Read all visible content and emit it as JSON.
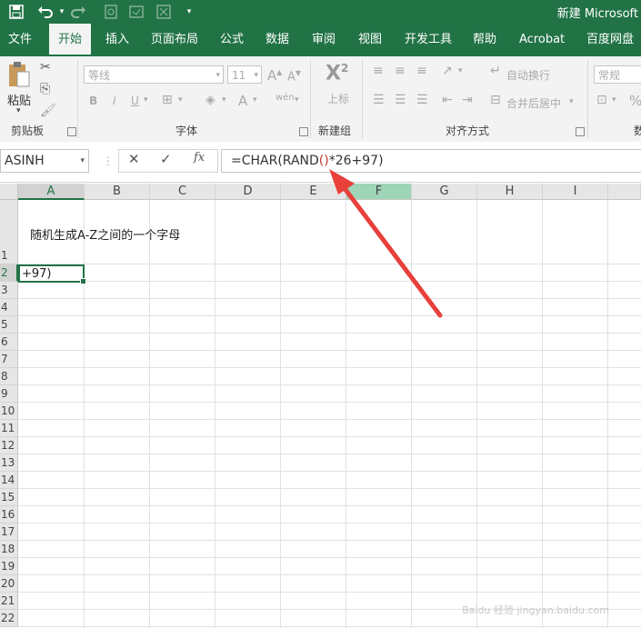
{
  "titlebar": {
    "title": "新建 Microsoft",
    "save_icon": "save-icon",
    "undo_icon": "undo-icon",
    "redo_icon": "redo-icon",
    "customize_icon": "customize-qat-icon"
  },
  "tabs": [
    {
      "label": "文件"
    },
    {
      "label": "开始"
    },
    {
      "label": "插入"
    },
    {
      "label": "页面布局"
    },
    {
      "label": "公式"
    },
    {
      "label": "数据"
    },
    {
      "label": "审阅"
    },
    {
      "label": "视图"
    },
    {
      "label": "开发工具"
    },
    {
      "label": "帮助"
    },
    {
      "label": "Acrobat"
    },
    {
      "label": "百度网盘"
    }
  ],
  "ribbon": {
    "clipboard": {
      "paste_label": "粘贴",
      "group_label": "剪贴板"
    },
    "font": {
      "font_name": "等线",
      "font_size": "11",
      "bold": "B",
      "italic": "I",
      "underline": "U",
      "font_color": "A",
      "phonetic": "wén",
      "group_label": "字体"
    },
    "newgroup": {
      "superscript_label": "上标",
      "group_label": "新建组"
    },
    "alignment": {
      "wrap_text": "自动换行",
      "merge_center": "合并后居中",
      "group_label": "对齐方式"
    },
    "number": {
      "format": "常规",
      "percent": "%",
      "group_label": "数"
    }
  },
  "formula_bar": {
    "name_box": "ASINH",
    "cancel_icon": "✕",
    "enter_icon": "✓",
    "fx_label": "fx",
    "formula_prefix": "=CHAR(RAND",
    "formula_parens": "()",
    "formula_suffix": "*26+97)"
  },
  "columns": [
    "A",
    "B",
    "C",
    "D",
    "E",
    "F",
    "G",
    "H",
    "I"
  ],
  "rows": [
    "1",
    "2",
    "3",
    "4",
    "5",
    "6",
    "7",
    "8",
    "9",
    "10",
    "11",
    "12",
    "13",
    "14",
    "15",
    "16",
    "17",
    "18",
    "19",
    "20",
    "21",
    "22"
  ],
  "cells": {
    "A1": "随机生成A-Z之间的一个字母",
    "A2": "+97)"
  },
  "colors": {
    "accent": "#217346",
    "arrow": "#e8403a",
    "paren_highlight": "#c0392b"
  },
  "watermark": "Baidu 经验 jingyan.baidu.com"
}
